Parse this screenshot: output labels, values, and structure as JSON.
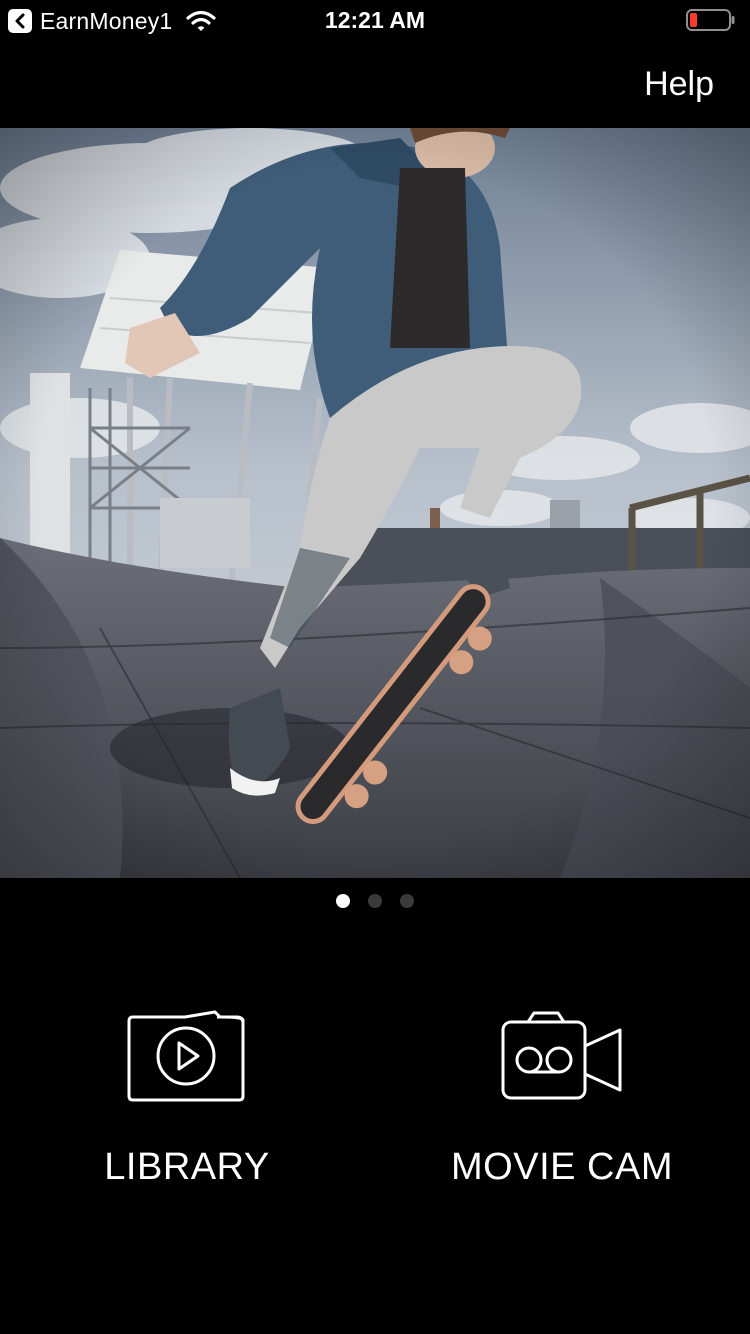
{
  "status_bar": {
    "back_app": "EarnMoney1",
    "time": "12:21 AM",
    "battery_color": "#ff3b30"
  },
  "nav": {
    "help_label": "Help"
  },
  "hero": {
    "image_subject": "skateboarder",
    "page_count": 3,
    "active_page": 1
  },
  "actions": {
    "library": {
      "label": "LIBRARY",
      "icon": "library-play-icon"
    },
    "movie_cam": {
      "label": "MOVIE CAM",
      "icon": "video-camera-icon"
    }
  }
}
